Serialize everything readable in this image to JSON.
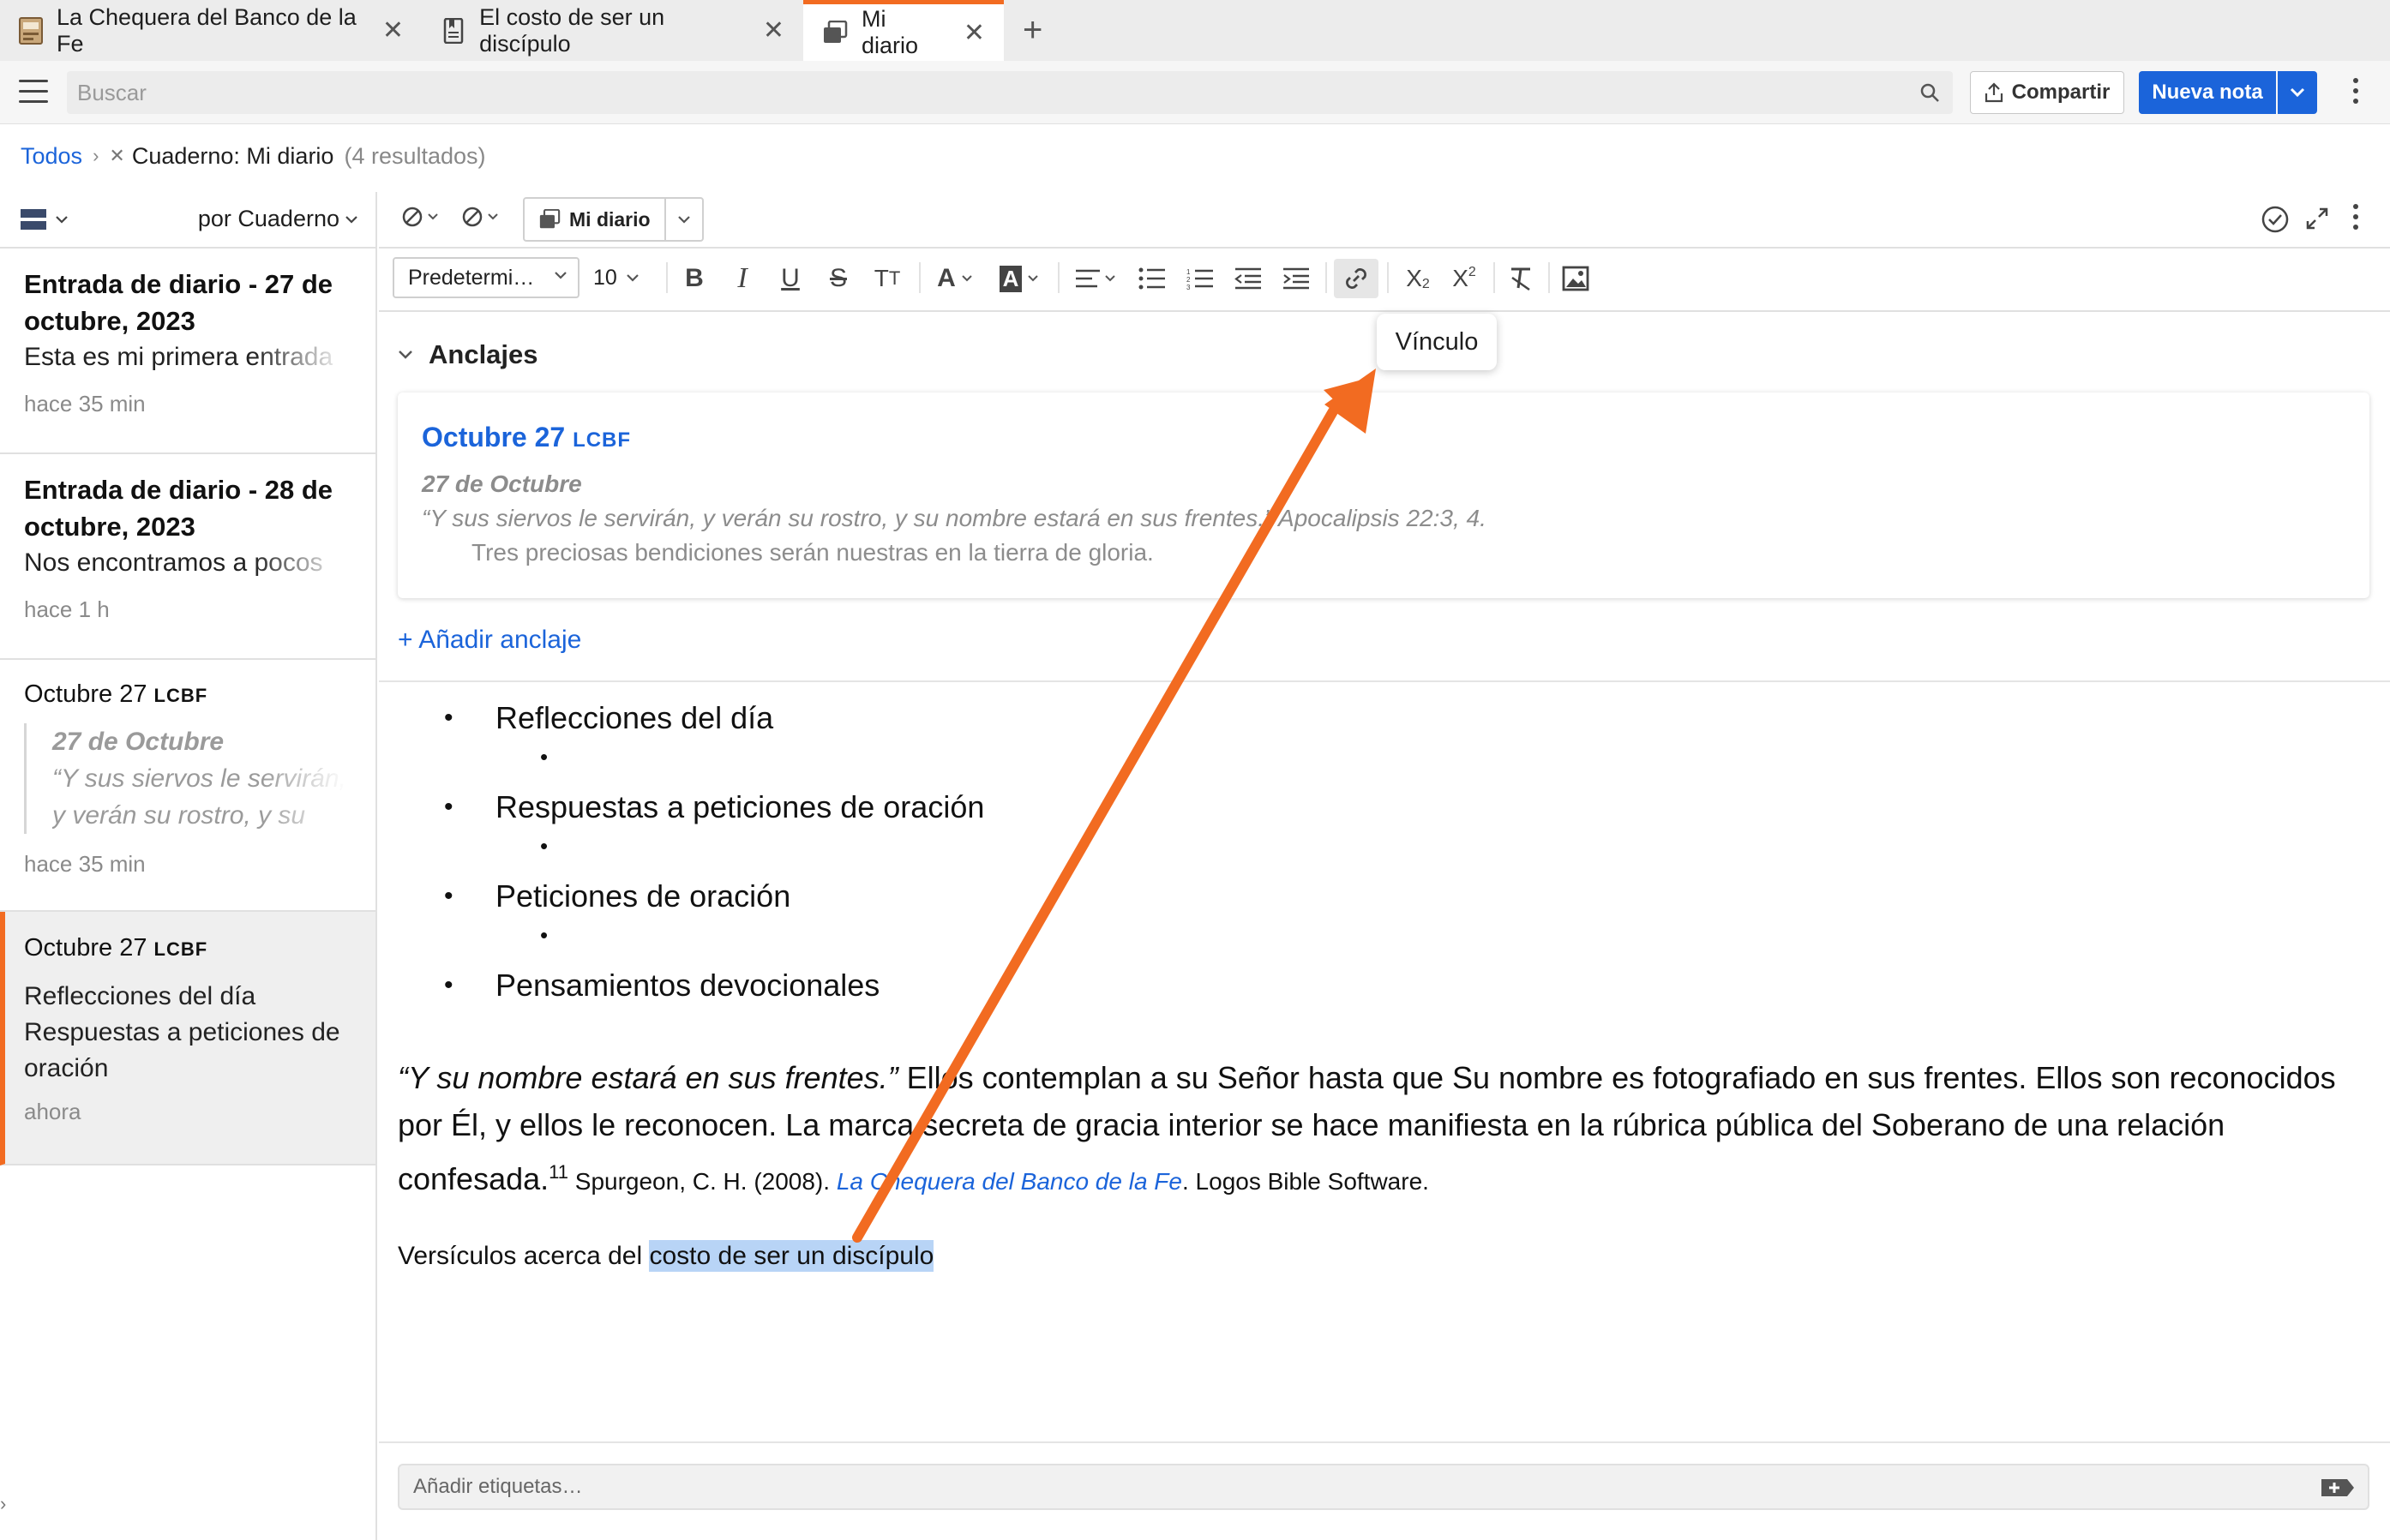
{
  "tabs": [
    {
      "label": "La Chequera del Banco de la Fe",
      "icon": "book-cover-icon"
    },
    {
      "label": "El costo de ser un discípulo",
      "icon": "bookmark-doc-icon"
    },
    {
      "label": "Mi diario",
      "icon": "notes-stack-icon",
      "active": true
    }
  ],
  "topbar": {
    "search_placeholder": "Buscar",
    "share_label": "Compartir",
    "new_note_label": "Nueva nota"
  },
  "breadcrumb": {
    "root": "Todos",
    "filter": "Cuaderno: Mi diario",
    "count": "(4 resultados)"
  },
  "left_panel": {
    "sort_label": "por Cuaderno",
    "notes": [
      {
        "title": "Entrada de diario - 27 de octubre, 2023",
        "title_l1": "Entrada de diario - 27 de",
        "title_l2": "octubre, 2023",
        "snippet": "Esta es mi primera entrada",
        "time": "hace 35 min"
      },
      {
        "title": "Entrada de diario - 28 de octubre, 2023",
        "title_l1": "Entrada de diario - 28 de",
        "title_l2": "octubre, 2023",
        "snippet": "Nos encontramos a pocos",
        "time": "hace 1 h"
      },
      {
        "title_main": "Octubre 27",
        "title_sc": "LCBF",
        "quote_head": "27 de Octubre",
        "quote_l1": "“Y sus siervos le servirán,",
        "quote_l2": "y verán su rostro, y su",
        "time": "hace 35 min"
      },
      {
        "title_main": "Octubre 27",
        "title_sc": "LCBF",
        "line1": "Reflecciones del día",
        "line2": "Respuestas a peticiones de",
        "line3": "oración",
        "time": "ahora",
        "selected": true
      }
    ]
  },
  "editor": {
    "notebook_label": "Mi diario",
    "font_family": "Predetermi…",
    "font_size": "10",
    "tooltip": "Vínculo",
    "anchors_label": "Anclajes",
    "anchor": {
      "title": "Octubre 27",
      "title_sc": "LCBF",
      "quote_head": "27 de Octubre",
      "quote": "“Y sus siervos le servirán, y verán su rostro, y su nombre estará en sus frentes.” Apocalipsis 22:3, 4.",
      "body": "Tres preciosas bendiciones serán nuestras en la tierra de gloria."
    },
    "add_anchor_label": "+ Añadir anclaje",
    "bullets": [
      "Reflecciones del día",
      "Respuestas a peticiones de oración",
      "Peticiones de oración",
      "Pensamientos devocionales"
    ],
    "paragraph": {
      "quote": "“Y su nombre estará en sus frentes.”",
      "text": " Ellos contemplan a su Señor hasta que Su nombre es fotografiado en sus frentes. Ellos son reconocidos por Él, y ellos le reconocen. La marca secreta de gracia interior se hace manifiesta en la rúbrica pública del Soberano de una relación confesada.",
      "sup": "11",
      "citation_pre": " Spurgeon, C. H. (2008). ",
      "citation_link": "La Chequera del Banco de la Fe",
      "citation_post": ". Logos Bible Software."
    },
    "verses_prefix": "Versículos acerca del ",
    "verses_highlight": "costo de ser un discípulo",
    "tags_placeholder": "Añadir etiquetas…"
  },
  "colors": {
    "accent": "#f26b21",
    "link": "#1b64da",
    "primary_button": "#1b64da",
    "highlight": "#b8d4f6"
  }
}
